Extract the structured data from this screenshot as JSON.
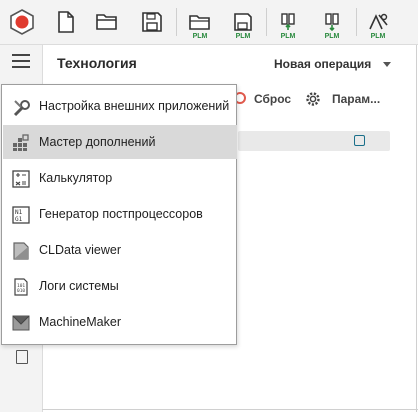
{
  "toolbar": {
    "plm_label": "PLM",
    "buttons": [
      {
        "name": "app-logo-icon"
      },
      {
        "name": "new-file-icon"
      },
      {
        "name": "open-folder-icon"
      },
      {
        "name": "save-icon"
      },
      {
        "name": "open-plm-icon"
      },
      {
        "name": "save-plm-icon"
      },
      {
        "name": "import-plm-icon"
      },
      {
        "name": "export-plm-icon"
      },
      {
        "name": "tools-plm-icon"
      }
    ]
  },
  "panel": {
    "title": "Технология",
    "new_operation": "Новая операция",
    "reset_label": "Сброс",
    "params_label": "Парам..."
  },
  "menu": {
    "items": [
      {
        "label": "Настройка внешних приложений",
        "icon": "wrench-settings-icon"
      },
      {
        "label": "Мастер дополнений",
        "icon": "addons-grid-icon"
      },
      {
        "label": "Калькулятор",
        "icon": "calculator-icon"
      },
      {
        "label": "Генератор постпроцессоров",
        "icon": "postprocessor-generator-icon"
      },
      {
        "label": "CLData viewer",
        "icon": "cldata-viewer-icon"
      },
      {
        "label": "Логи системы",
        "icon": "system-logs-icon"
      },
      {
        "label": "MachineMaker",
        "icon": "machinemaker-icon"
      }
    ],
    "active_index": 1
  },
  "colors": {
    "accent_red": "#e03b2f",
    "plm_green": "#2a8a3e",
    "menu_highlight": "#d9d9d9"
  }
}
